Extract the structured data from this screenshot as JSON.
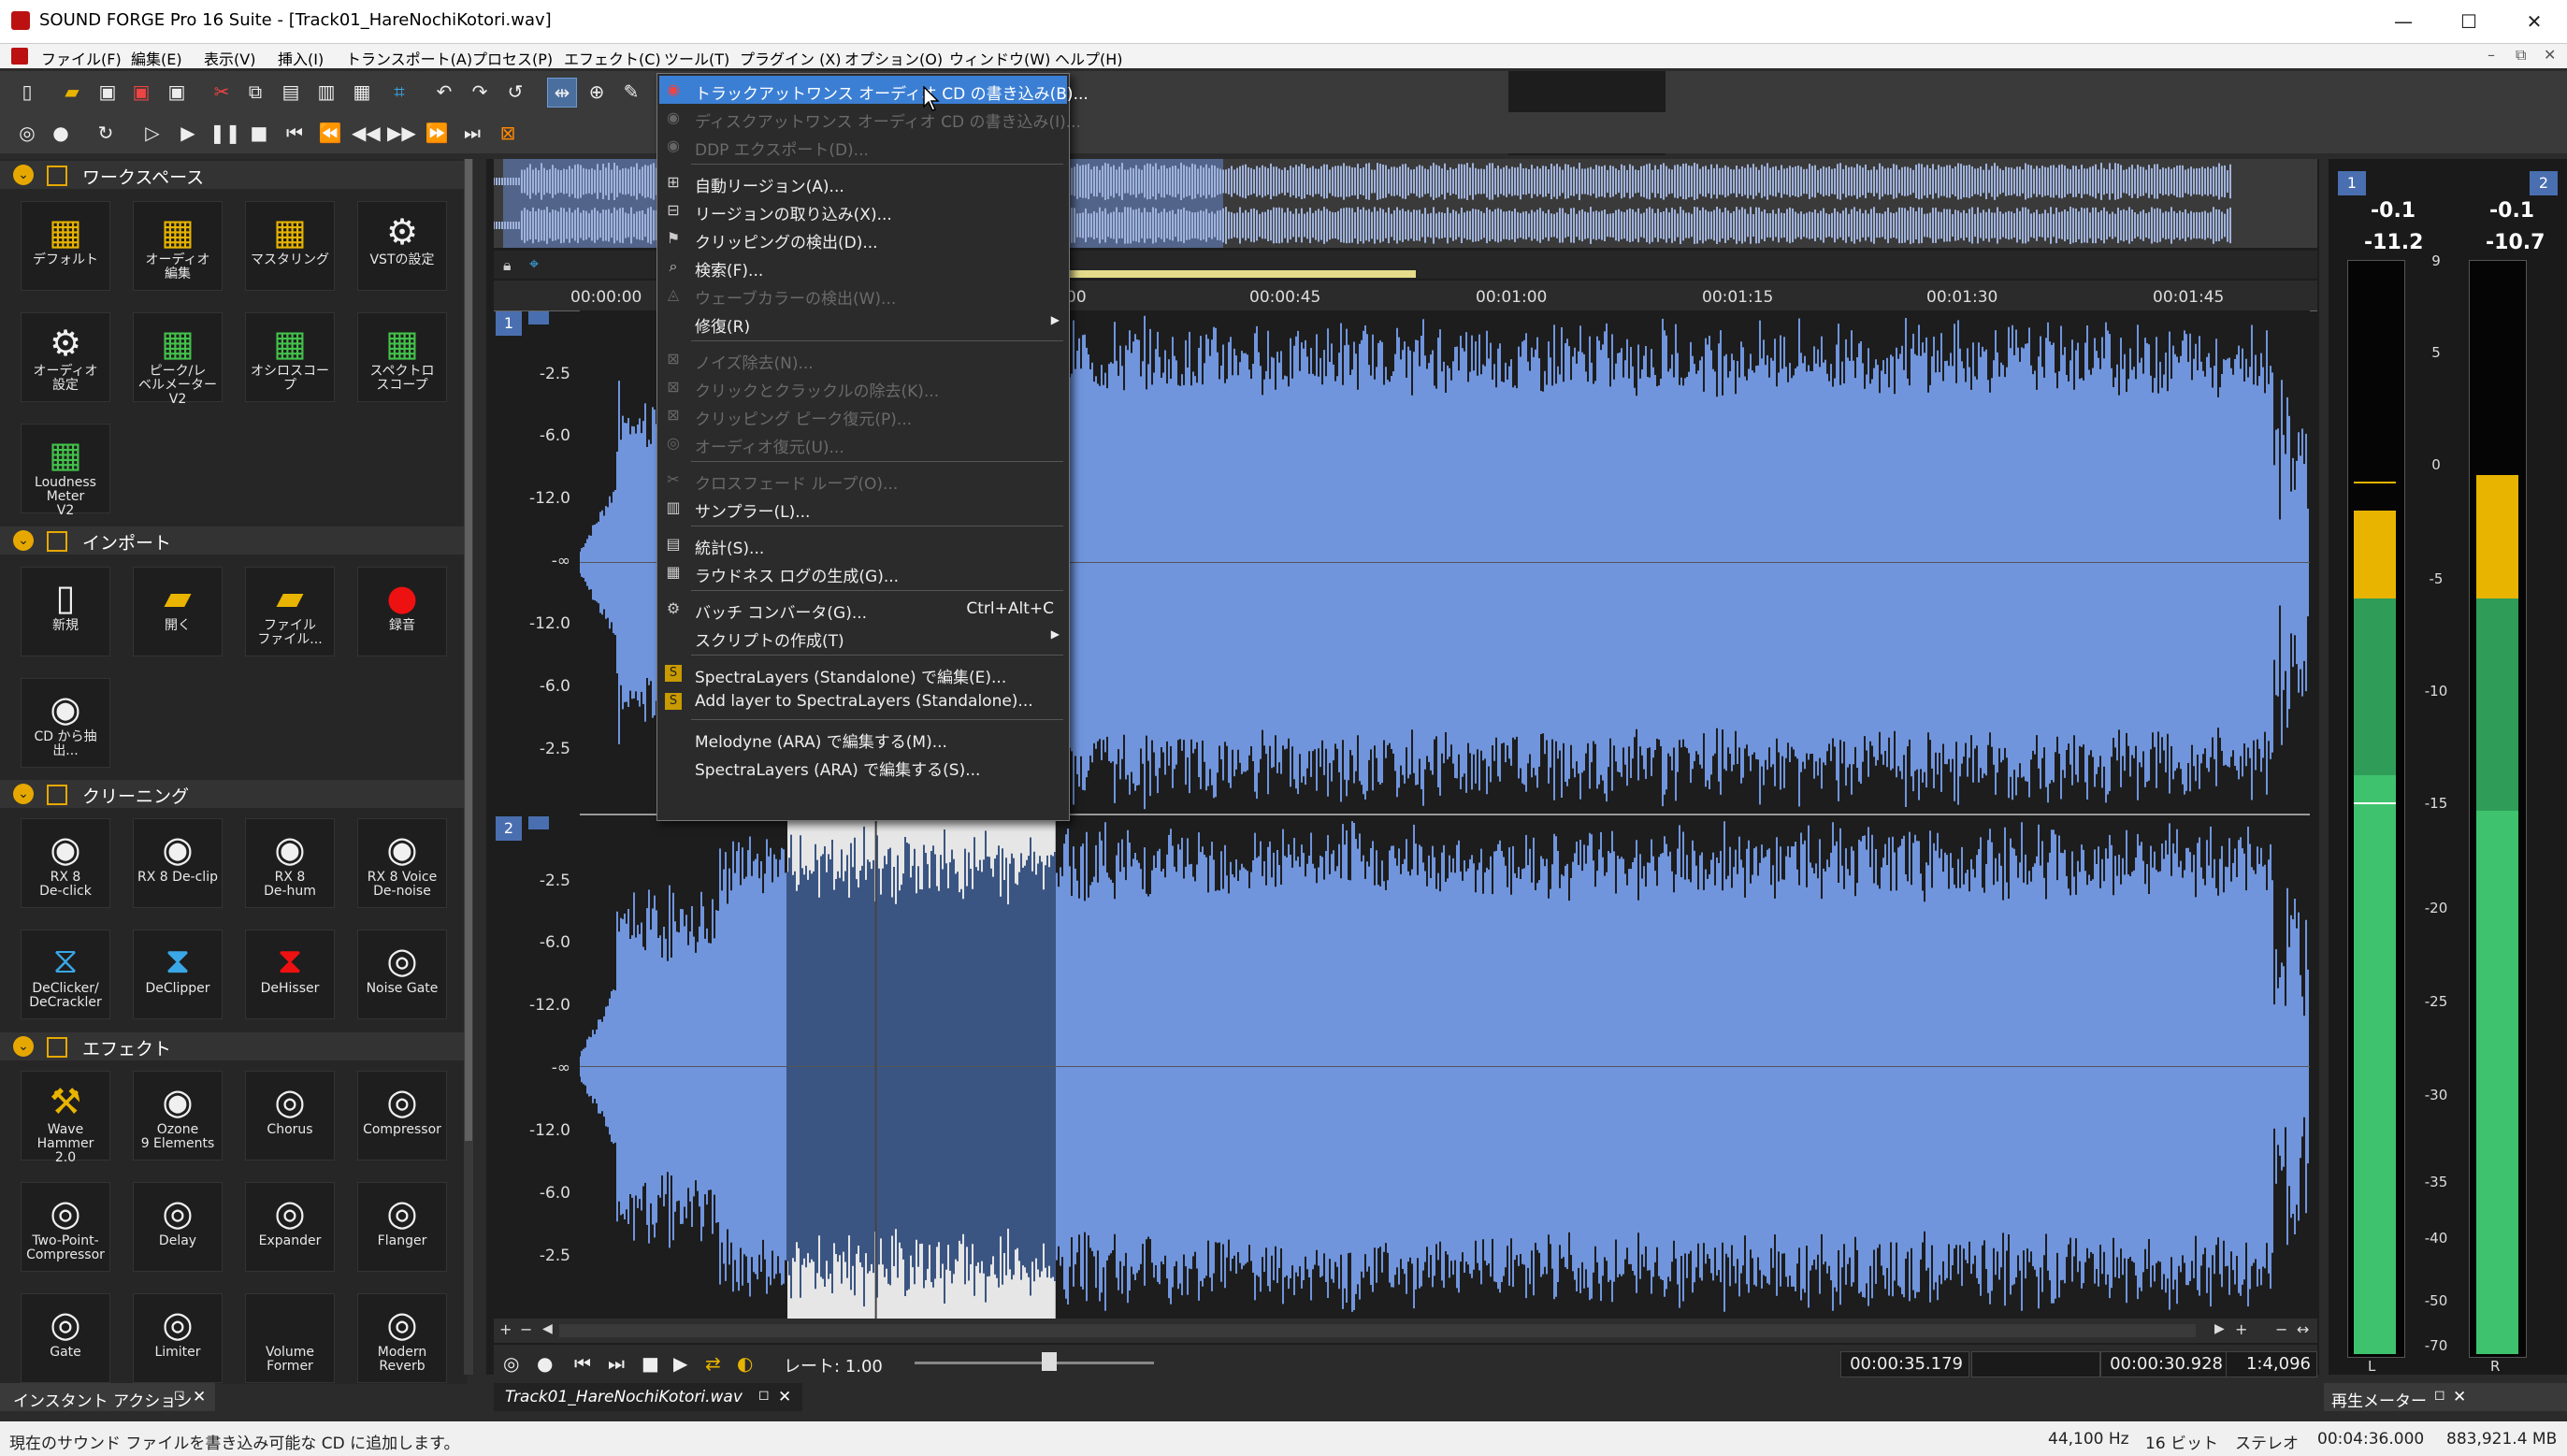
{
  "window": {
    "title": "SOUND FORGE Pro 16 Suite - [Track01_HareNochiKotori.wav]",
    "minimize": "—",
    "maximize": "☐",
    "close": "✕"
  },
  "menubar": {
    "items": [
      "ファイル(F)",
      "編集(E)",
      "表示(V)",
      "挿入(I)",
      "トランスポート(A)",
      "プロセス(P)",
      "エフェクト(C)",
      "ツール(T)",
      "プラグイン (X)",
      "オプション(O)",
      "ウィンドウ(W)",
      "ヘルプ(H)"
    ],
    "mdi_controls": [
      "–",
      "⧉",
      "✕"
    ]
  },
  "workspace": {
    "sections": [
      {
        "title": "ワークスペース",
        "tiles": [
          {
            "label": "デフォルト",
            "icon": "layout-icon"
          },
          {
            "label": "オーディオ\n編集",
            "icon": "layout-icon"
          },
          {
            "label": "マスタリング",
            "icon": "layout-icon"
          },
          {
            "label": "VSTの設定",
            "icon": "gear-icon"
          },
          {
            "label": "オーディオ\n設定",
            "icon": "gear-icon"
          },
          {
            "label": "ピーク/レ\nベルメーター\nV2",
            "icon": "meter-icon"
          },
          {
            "label": "オシロスコープ",
            "icon": "meter-icon"
          },
          {
            "label": "スペクトロ\nスコープ",
            "icon": "meter-icon"
          },
          {
            "label": "Loudness\nMeter\nV2",
            "icon": "meter-icon"
          }
        ]
      },
      {
        "title": "インポート",
        "tiles": [
          {
            "label": "新規",
            "icon": "new-file-icon"
          },
          {
            "label": "開く",
            "icon": "folder-icon"
          },
          {
            "label": "ファイル\nファイル...",
            "icon": "folder-search-icon"
          },
          {
            "label": "録音",
            "icon": "record-icon"
          },
          {
            "label": "CD から抽出...",
            "icon": "cd-extract-icon"
          }
        ]
      },
      {
        "title": "クリーニング",
        "tiles": [
          {
            "label": "RX 8\nDe-click",
            "icon": "rx-icon"
          },
          {
            "label": "RX 8 De-clip",
            "icon": "rx-icon"
          },
          {
            "label": "RX 8\nDe-hum",
            "icon": "rx-icon"
          },
          {
            "label": "RX 8 Voice\nDe-noise",
            "icon": "rx-icon"
          },
          {
            "label": "DeClicker/\nDeCrackler",
            "icon": "declicker-icon"
          },
          {
            "label": "DeClipper",
            "icon": "declipper-icon"
          },
          {
            "label": "DeHisser",
            "icon": "dehisser-icon"
          },
          {
            "label": "Noise Gate",
            "icon": "noise-gate-icon"
          }
        ]
      },
      {
        "title": "エフェクト",
        "tiles": [
          {
            "label": "Wave\nHammer\n2.0",
            "icon": "hammer-icon"
          },
          {
            "label": "Ozone\n9 Elements",
            "icon": "ozone-icon"
          },
          {
            "label": "Chorus",
            "icon": "effect-icon"
          },
          {
            "label": "Compressor",
            "icon": "effect-icon"
          },
          {
            "label": "Two-Point-\nCompressor",
            "icon": "effect-icon"
          },
          {
            "label": "Delay",
            "icon": "effect-icon"
          },
          {
            "label": "Expander",
            "icon": "effect-icon"
          },
          {
            "label": "Flanger",
            "icon": "effect-icon"
          },
          {
            "label": "Gate",
            "icon": "effect-icon"
          },
          {
            "label": "Limiter",
            "icon": "effect-icon"
          },
          {
            "label": "Volume\nFormer",
            "icon": "effect-icon"
          },
          {
            "label": "Modern\nReverb",
            "icon": "reverb-icon"
          }
        ]
      }
    ]
  },
  "tools_menu": {
    "items": [
      {
        "label": "トラックアットワンス オーディオ CD の書き込み(B)...",
        "icon": "cd-burn-icon",
        "state": "highlighted"
      },
      {
        "label": "ディスクアットワンス オーディオ CD の書き込み(I)...",
        "icon": "cd-burn-icon",
        "state": "disabled"
      },
      {
        "label": "DDP エクスポート(D)...",
        "icon": "ddp-icon",
        "state": "disabled"
      },
      {
        "separator": true
      },
      {
        "label": "自動リージョン(A)...",
        "icon": "region-icon",
        "state": "enabled"
      },
      {
        "label": "リージョンの取り込み(X)...",
        "icon": "region-import-icon",
        "state": "enabled"
      },
      {
        "label": "クリッピングの検出(D)...",
        "icon": "clip-detect-icon",
        "state": "enabled"
      },
      {
        "label": "検索(F)...",
        "icon": "search-icon",
        "state": "enabled"
      },
      {
        "label": "ウェーブカラーの検出(W)...",
        "icon": "wave-color-icon",
        "state": "disabled"
      },
      {
        "label": "修復(R)",
        "icon": "",
        "state": "enabled",
        "submenu": true
      },
      {
        "separator": true
      },
      {
        "label": "ノイズ除去(N)...",
        "icon": "noise-icon",
        "state": "disabled"
      },
      {
        "label": "クリックとクラックルの除去(K)...",
        "icon": "click-icon",
        "state": "disabled"
      },
      {
        "label": "クリッピング ピーク復元(P)...",
        "icon": "clip-restore-icon",
        "state": "disabled"
      },
      {
        "label": "オーディオ復元(U)...",
        "icon": "audio-restore-icon",
        "state": "disabled"
      },
      {
        "separator": true
      },
      {
        "label": "クロスフェード ループ(O)...",
        "icon": "crossfade-icon",
        "state": "disabled"
      },
      {
        "label": "サンプラー(L)...",
        "icon": "sampler-icon",
        "state": "enabled"
      },
      {
        "separator": true
      },
      {
        "label": "統計(S)...",
        "icon": "stats-icon",
        "state": "enabled"
      },
      {
        "label": "ラウドネス ログの生成(G)...",
        "icon": "loudness-icon",
        "state": "enabled"
      },
      {
        "separator": true
      },
      {
        "label": "バッチ コンバータ(G)...",
        "icon": "batch-icon",
        "state": "enabled",
        "shortcut": "Ctrl+Alt+C"
      },
      {
        "label": "スクリプトの作成(T)",
        "icon": "",
        "state": "enabled",
        "submenu": true
      },
      {
        "separator": true
      },
      {
        "label": "SpectraLayers (Standalone) で編集(E)...",
        "icon": "spectralayers-icon",
        "state": "enabled"
      },
      {
        "label": "Add layer to SpectraLayers (Standalone)...",
        "icon": "spectralayers-icon",
        "state": "enabled"
      },
      {
        "separator": true
      },
      {
        "label": "Melodyne (ARA) で編集する(M)...",
        "icon": "",
        "state": "enabled"
      },
      {
        "label": "SpectraLayers (ARA) で編集する(S)...",
        "icon": "",
        "state": "enabled"
      }
    ]
  },
  "datawindow": {
    "ruler": [
      "00:00:00",
      "00",
      "00:00:45",
      "00:01:00",
      "00:01:15",
      "00:01:30",
      "00:01:45"
    ],
    "channel1_label": "1",
    "channel2_label": "2",
    "db_labels": [
      "-2.5",
      "-6.0",
      "-12.0",
      "-∞",
      "-12.0",
      "-6.0",
      "-2.5"
    ],
    "rate_label": "レート: 1.00",
    "time_cursor": "00:00:35.179",
    "time_length": "00:00:30.928",
    "zoom": "1:4,096",
    "tab": "Track01_HareNochiKotori.wav",
    "selection_start_fraction": 0.12,
    "selection_end_fraction": 0.275,
    "colors": {
      "wave": "#7095dd",
      "wave_selected": "#3b5583",
      "selection_bg": "#e6e6e6",
      "background": "#1d1d1d"
    }
  },
  "meters": {
    "ch1": "1",
    "ch2": "2",
    "peak_l": "-0.1",
    "peak_r": "-0.1",
    "rms_l": "-11.2",
    "rms_r": "-10.7",
    "scale": [
      "9",
      "5",
      "0",
      "-5",
      "-10",
      "-15",
      "-20",
      "-25",
      "-30",
      "-35",
      "-40",
      "-50",
      "-70"
    ],
    "label_l": "L",
    "label_r": "R",
    "level_l_db": -20,
    "level_r_db": -22
  },
  "panels": {
    "instant_action": "インスタント アクション",
    "playback_meter": "再生メーター"
  },
  "statusbar": {
    "message": "現在のサウンド ファイルを書き込み可能な CD に追加します。",
    "samplerate": "44,100 Hz",
    "bits": "16 ビット",
    "channels": "ステレオ",
    "length": "00:04:36.000",
    "size": "883,921.4 MB"
  }
}
